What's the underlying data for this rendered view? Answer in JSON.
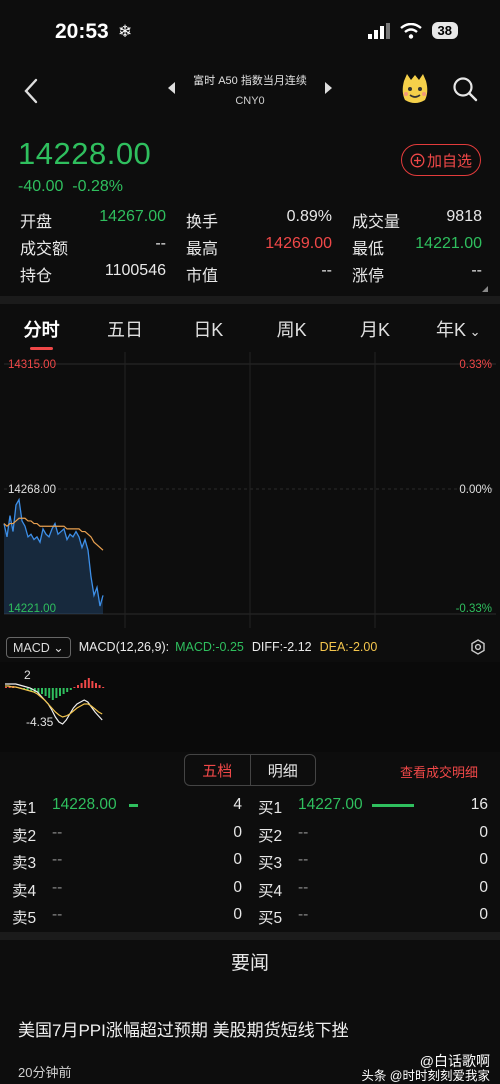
{
  "status_bar": {
    "time": "20:53",
    "battery": "38"
  },
  "header": {
    "title": "富时 A50 指数当月连续",
    "currency": "CNY0"
  },
  "quote": {
    "price": "14228.00",
    "change": "-40.00",
    "change_pct": "-0.28%",
    "add_fav_label": "加自选",
    "stats": [
      [
        {
          "label": "开盘",
          "value": "14267.00",
          "color": "green"
        },
        {
          "label": "换手",
          "value": "0.89%",
          "color": ""
        },
        {
          "label": "成交量",
          "value": "9818",
          "color": ""
        }
      ],
      [
        {
          "label": "成交额",
          "value": "--",
          "color": ""
        },
        {
          "label": "最高",
          "value": "14269.00",
          "color": "red"
        },
        {
          "label": "最低",
          "value": "14221.00",
          "color": "green"
        }
      ],
      [
        {
          "label": "持仓",
          "value": "1100546",
          "color": ""
        },
        {
          "label": "市值",
          "value": "--",
          "color": ""
        },
        {
          "label": "涨停",
          "value": "--",
          "color": ""
        }
      ]
    ]
  },
  "tabs": [
    "分时",
    "五日",
    "日K",
    "周K",
    "月K",
    "年K"
  ],
  "chart_data": {
    "type": "line",
    "title": "",
    "y_labels_left": [
      "14315.00",
      "14268.00",
      "14221.00"
    ],
    "y_labels_right": [
      "0.33%",
      "0.00%",
      "-0.33%"
    ],
    "ylim": [
      14221,
      14315
    ],
    "series": [
      {
        "values": [
          14255,
          14250,
          14258,
          14252,
          14262,
          14264,
          14256,
          14254,
          14250,
          14251,
          14249,
          14250,
          14248,
          14253,
          14251,
          14250,
          14253,
          14255,
          14251,
          14252,
          14253,
          14249,
          14251,
          14250,
          14252,
          14250,
          14246,
          14249,
          14245,
          14235,
          14228,
          14231,
          14224,
          14228
        ]
      },
      {
        "values": [
          14255,
          14254,
          14255,
          14255,
          14256,
          14257,
          14257,
          14257,
          14256,
          14256,
          14255,
          14255,
          14254,
          14254,
          14254,
          14254,
          14254,
          14254,
          14254,
          14254,
          14254,
          14253,
          14253,
          14253,
          14253,
          14253,
          14252,
          14252,
          14251,
          14250,
          14248,
          14247,
          14246,
          14245
        ]
      }
    ]
  },
  "macd": {
    "selector": "MACD",
    "params": "MACD(12,26,9):",
    "macd_value": "MACD:-0.25",
    "diff_value": "DIFF:-2.12",
    "dea_value": "DEA:-2.00",
    "upper_label": "2",
    "lower_label": "-4.35"
  },
  "order_book": {
    "tab_active": "五档",
    "tab_inactive": "明细",
    "trade_link": "查看成交明细",
    "rows": [
      {
        "sell_label": "卖1",
        "sell_price": "14228.00",
        "sell_qty": "4",
        "buy_label": "买1",
        "buy_price": "14227.00",
        "buy_qty": "16"
      },
      {
        "sell_label": "卖2",
        "sell_price": "--",
        "sell_qty": "0",
        "buy_label": "买2",
        "buy_price": "--",
        "buy_qty": "0"
      },
      {
        "sell_label": "卖3",
        "sell_price": "--",
        "sell_qty": "0",
        "buy_label": "买3",
        "buy_price": "--",
        "buy_qty": "0"
      },
      {
        "sell_label": "卖4",
        "sell_price": "--",
        "sell_qty": "0",
        "buy_label": "买4",
        "buy_price": "--",
        "buy_qty": "0"
      },
      {
        "sell_label": "卖5",
        "sell_price": "--",
        "sell_qty": "0",
        "buy_label": "买5",
        "buy_price": "--",
        "buy_qty": "0"
      }
    ],
    "sell_level_fraction": 0.25,
    "buy_level_fraction": 1.0
  },
  "news": {
    "heading": "要闻",
    "title": "美国7月PPI涨幅超过预期 美股期货短线下挫",
    "time": "20分钟前",
    "watermark_line1": "@白话歌啊",
    "watermark_line2": "头条 @时时刻刻爱我家"
  },
  "colors": {
    "up": "#f04848",
    "down": "#2fbf5e",
    "avg_line": "#e8a050",
    "price_line": "#3d8fe8"
  }
}
